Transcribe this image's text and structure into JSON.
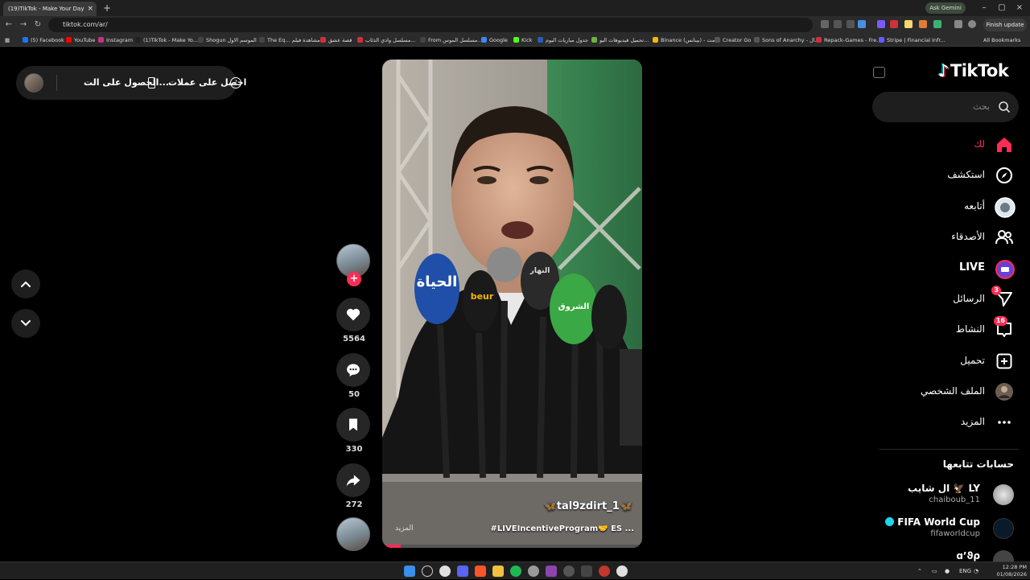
{
  "browser": {
    "tab_title": "(19)TikTok - Make Your Day",
    "new_tab": "+",
    "ask_gemini": "Ask Gemini",
    "url": "tiktok.com/ar/",
    "finish_update": "Finish update",
    "bookmarks": [
      {
        "label": "(5) Facebook",
        "color": "#1877f2"
      },
      {
        "label": "YouTube",
        "color": "#ff0000"
      },
      {
        "label": "Instagram",
        "color": "#c13584"
      },
      {
        "label": "(1)TikTok - Make Yo...",
        "color": "#222222"
      },
      {
        "label": "Shogun الموسم الاول",
        "color": "#444444"
      },
      {
        "label": "The Eq... مشاهدة فيلم",
        "color": "#444444"
      },
      {
        "label": "قصة عشق",
        "color": "#d0303c"
      },
      {
        "label": "مسلسل وادي الذئاب...",
        "color": "#d0303c"
      },
      {
        "label": "From مسلسل الموس...",
        "color": "#444444"
      },
      {
        "label": "Google",
        "color": "#4285f4"
      },
      {
        "label": "Kick",
        "color": "#53fc18"
      },
      {
        "label": "جدول مباريات اليوم",
        "color": "#2a5db0"
      },
      {
        "label": "تحميل فيديوهات اليو...",
        "color": "#6cb33f"
      },
      {
        "label": "Binance (بينانس) - مت...",
        "color": "#f0b90b"
      },
      {
        "label": "Creator Go",
        "color": "#555555"
      },
      {
        "label": "Sons of Anarchy - ال...",
        "color": "#555555"
      },
      {
        "label": "Repack-Games - Fre...",
        "color": "#d0303c"
      },
      {
        "label": "Stripe | Financial Infr...",
        "color": "#635bff"
      }
    ],
    "all_bookmarks": "All Bookmarks"
  },
  "promo": {
    "get_app": "الحصول على الت...",
    "get_coins": "احصل على عملات"
  },
  "video": {
    "username": "🦋tal9zdirt_1🦋",
    "caption": "#LIVEIncentiveProgram🤝 ES ...",
    "more": "المزيد",
    "progress_fraction": 0.07,
    "mic_labels": [
      "الحياة",
      "beur",
      "الشروق",
      "النهار"
    ]
  },
  "actions": {
    "likes": "5564",
    "comments": "50",
    "saves": "330",
    "shares": "272"
  },
  "sidebar": {
    "logo": "TikTok",
    "search_placeholder": "بحث",
    "nav": [
      {
        "label": "لك",
        "icon": "home-icon",
        "active": true
      },
      {
        "label": "استكشف",
        "icon": "compass-icon"
      },
      {
        "label": "أتابعه",
        "icon": "following-avatar-icon"
      },
      {
        "label": "الأصدقاء",
        "icon": "friends-icon"
      },
      {
        "label": "LIVE",
        "icon": "live-icon"
      },
      {
        "label": "الرسائل",
        "icon": "send-icon",
        "badge": "3"
      },
      {
        "label": "النشاط",
        "icon": "inbox-icon",
        "badge": "16"
      },
      {
        "label": "تحميل",
        "icon": "upload-icon"
      },
      {
        "label": "الملف الشخصي",
        "icon": "profile-avatar-icon"
      },
      {
        "label": "المزيد",
        "icon": "more-dots-icon"
      }
    ],
    "following_title": "حسابات تتابعها",
    "accounts": [
      {
        "name": "ال شايب 🦅 LY",
        "handle": "chaiboub_11"
      },
      {
        "name": "FIFA World Cup",
        "handle": "fifaworldcup",
        "verified": true
      },
      {
        "name": "ɑ’ϑρ",
        "handle": ""
      }
    ],
    "accent": "#fe2c55"
  },
  "taskbar": {
    "lang": "ENG",
    "time": "12:28 PM",
    "date": "01/08/2026"
  }
}
